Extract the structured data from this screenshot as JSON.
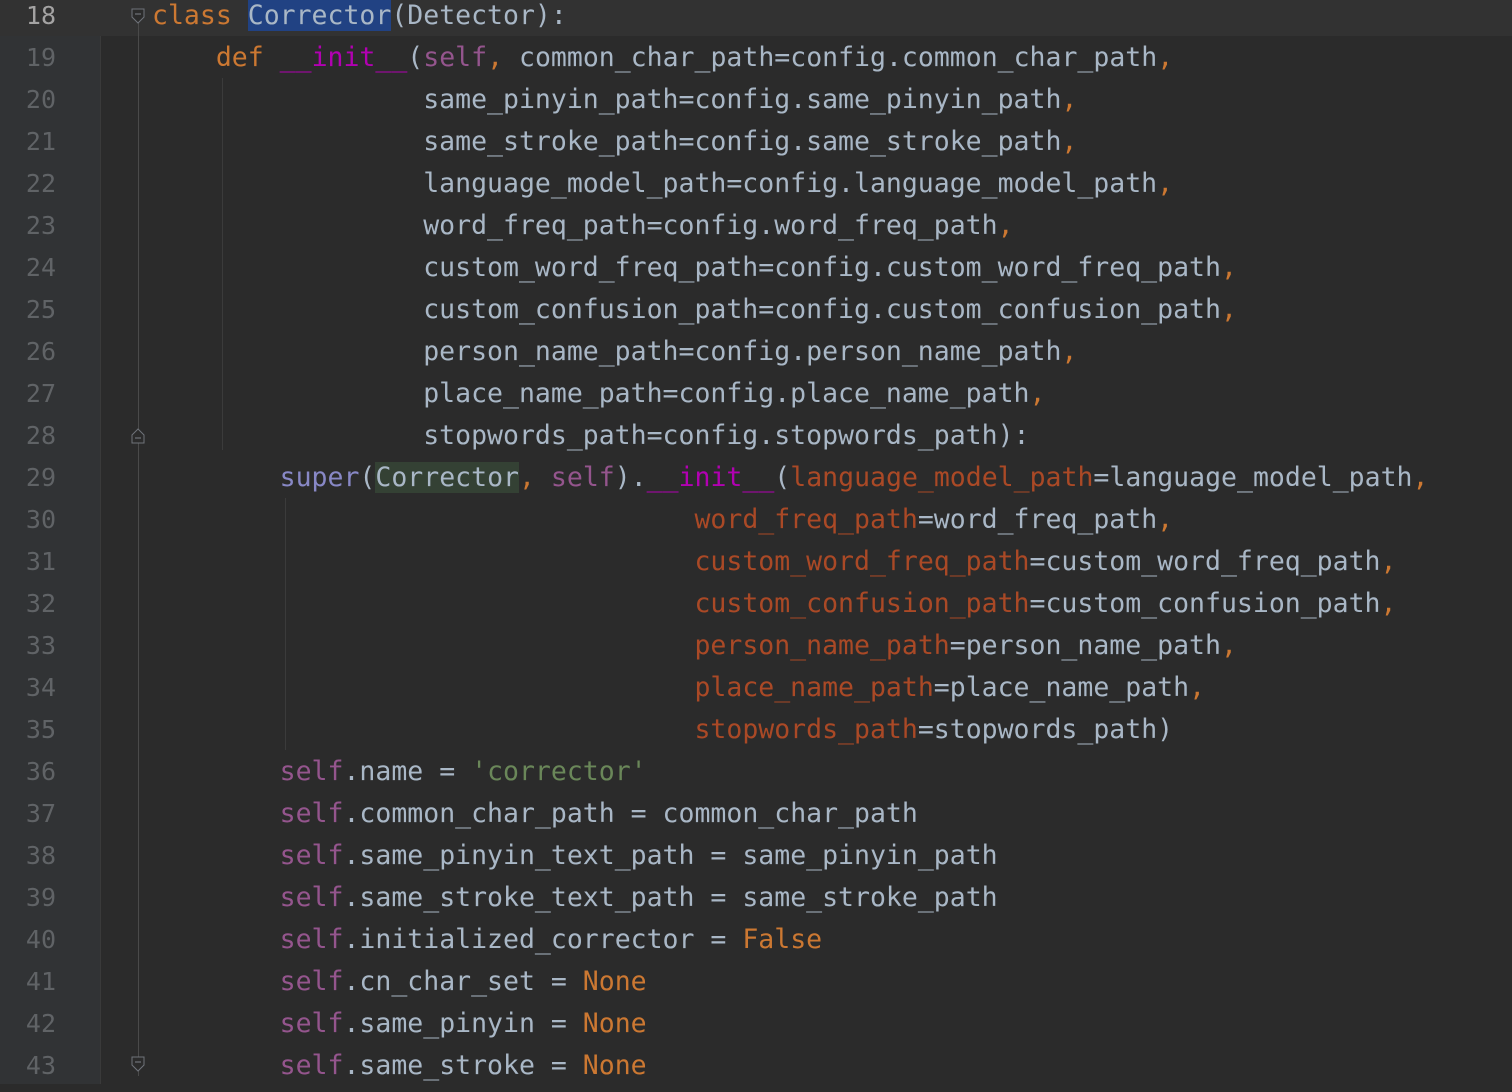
{
  "editor": {
    "colors": {
      "background": "#2b2b2b",
      "keyword": "#cc7832",
      "self": "#94558d",
      "magic": "#b200b2",
      "builtin": "#8888c6",
      "named_arg": "#aa4926",
      "string": "#6a8759",
      "default_text": "#a9b7c6",
      "selection": "#214283"
    },
    "current_line": 18,
    "lines": [
      {
        "n": "18",
        "t": [
          [
            "kw",
            "class "
          ],
          [
            "sel",
            "Corrector"
          ],
          [
            "",
            "(Detector):"
          ]
        ]
      },
      {
        "n": "19",
        "t": [
          [
            "",
            "    "
          ],
          [
            "kw",
            "def "
          ],
          [
            "magic",
            "__init__"
          ],
          [
            "",
            "("
          ],
          [
            "self",
            "self"
          ],
          [
            "kw",
            ", "
          ],
          [
            "",
            "common_char_path=config.common_char_path"
          ],
          [
            "kw",
            ","
          ]
        ]
      },
      {
        "n": "20",
        "t": [
          [
            "",
            "                 same_pinyin_path=config.same_pinyin_path"
          ],
          [
            "kw",
            ","
          ]
        ]
      },
      {
        "n": "21",
        "t": [
          [
            "",
            "                 same_stroke_path=config.same_stroke_path"
          ],
          [
            "kw",
            ","
          ]
        ]
      },
      {
        "n": "22",
        "t": [
          [
            "",
            "                 language_model_path=config.language_model_path"
          ],
          [
            "kw",
            ","
          ]
        ]
      },
      {
        "n": "23",
        "t": [
          [
            "",
            "                 word_freq_path=config.word_freq_path"
          ],
          [
            "kw",
            ","
          ]
        ]
      },
      {
        "n": "24",
        "t": [
          [
            "",
            "                 custom_word_freq_path=config.custom_word_freq_path"
          ],
          [
            "kw",
            ","
          ]
        ]
      },
      {
        "n": "25",
        "t": [
          [
            "",
            "                 custom_confusion_path=config.custom_confusion_path"
          ],
          [
            "kw",
            ","
          ]
        ]
      },
      {
        "n": "26",
        "t": [
          [
            "",
            "                 person_name_path=config.person_name_path"
          ],
          [
            "kw",
            ","
          ]
        ]
      },
      {
        "n": "27",
        "t": [
          [
            "",
            "                 place_name_path=config.place_name_path"
          ],
          [
            "kw",
            ","
          ]
        ]
      },
      {
        "n": "28",
        "t": [
          [
            "",
            "                 stopwords_path=config.stopwords_path):"
          ]
        ]
      },
      {
        "n": "29",
        "t": [
          [
            "",
            "        "
          ],
          [
            "builtin",
            "super"
          ],
          [
            "",
            "("
          ],
          [
            "hl",
            "Corrector"
          ],
          [
            "kw",
            ", "
          ],
          [
            "self",
            "self"
          ],
          [
            "",
            ")."
          ],
          [
            "magic",
            "__init__"
          ],
          [
            "",
            "("
          ],
          [
            "named",
            "language_model_path"
          ],
          [
            "",
            "=language_model_path"
          ],
          [
            "kw",
            ","
          ]
        ]
      },
      {
        "n": "30",
        "t": [
          [
            "",
            "                                  "
          ],
          [
            "named",
            "word_freq_path"
          ],
          [
            "",
            "=word_freq_path"
          ],
          [
            "kw",
            ","
          ]
        ]
      },
      {
        "n": "31",
        "t": [
          [
            "",
            "                                  "
          ],
          [
            "named",
            "custom_word_freq_path"
          ],
          [
            "",
            "=custom_word_freq_path"
          ],
          [
            "kw",
            ","
          ]
        ]
      },
      {
        "n": "32",
        "t": [
          [
            "",
            "                                  "
          ],
          [
            "named",
            "custom_confusion_path"
          ],
          [
            "",
            "=custom_confusion_path"
          ],
          [
            "kw",
            ","
          ]
        ]
      },
      {
        "n": "33",
        "t": [
          [
            "",
            "                                  "
          ],
          [
            "named",
            "person_name_path"
          ],
          [
            "",
            "=person_name_path"
          ],
          [
            "kw",
            ","
          ]
        ]
      },
      {
        "n": "34",
        "t": [
          [
            "",
            "                                  "
          ],
          [
            "named",
            "place_name_path"
          ],
          [
            "",
            "=place_name_path"
          ],
          [
            "kw",
            ","
          ]
        ]
      },
      {
        "n": "35",
        "t": [
          [
            "",
            "                                  "
          ],
          [
            "named",
            "stopwords_path"
          ],
          [
            "",
            "=stopwords_path)"
          ]
        ]
      },
      {
        "n": "36",
        "t": [
          [
            "",
            "        "
          ],
          [
            "self",
            "self"
          ],
          [
            "",
            ".name = "
          ],
          [
            "str",
            "'corrector'"
          ]
        ]
      },
      {
        "n": "37",
        "t": [
          [
            "",
            "        "
          ],
          [
            "self",
            "self"
          ],
          [
            "",
            ".common_char_path = common_char_path"
          ]
        ]
      },
      {
        "n": "38",
        "t": [
          [
            "",
            "        "
          ],
          [
            "self",
            "self"
          ],
          [
            "",
            ".same_pinyin_text_path = same_pinyin_path"
          ]
        ]
      },
      {
        "n": "39",
        "t": [
          [
            "",
            "        "
          ],
          [
            "self",
            "self"
          ],
          [
            "",
            ".same_stroke_text_path = same_stroke_path"
          ]
        ]
      },
      {
        "n": "40",
        "t": [
          [
            "",
            "        "
          ],
          [
            "self",
            "self"
          ],
          [
            "",
            ".initialized_corrector = "
          ],
          [
            "kw",
            "False"
          ]
        ]
      },
      {
        "n": "41",
        "t": [
          [
            "",
            "        "
          ],
          [
            "self",
            "self"
          ],
          [
            "",
            ".cn_char_set = "
          ],
          [
            "kw",
            "None"
          ]
        ]
      },
      {
        "n": "42",
        "t": [
          [
            "",
            "        "
          ],
          [
            "self",
            "self"
          ],
          [
            "",
            ".same_pinyin = "
          ],
          [
            "kw",
            "None"
          ]
        ]
      },
      {
        "n": "43",
        "t": [
          [
            "",
            "        "
          ],
          [
            "self",
            "self"
          ],
          [
            "",
            ".same_stroke = "
          ],
          [
            "kw",
            "None"
          ]
        ]
      }
    ]
  }
}
